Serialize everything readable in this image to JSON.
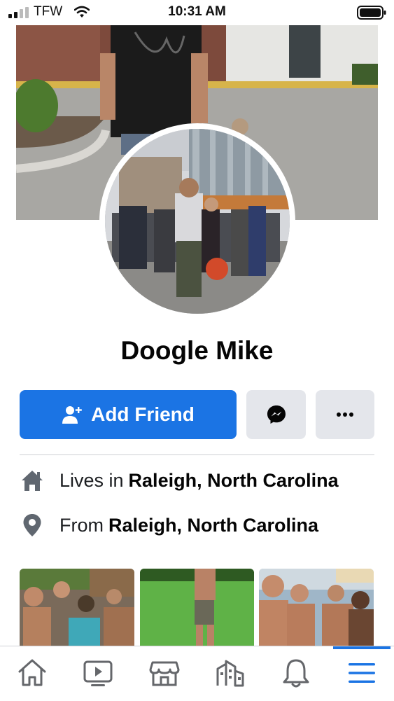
{
  "status_bar": {
    "carrier": "TFW",
    "time": "10:31 AM"
  },
  "profile": {
    "name": "Doogle Mike",
    "add_friend_label": "Add Friend",
    "message_icon": "messenger-icon",
    "more_icon": "more-dots-icon"
  },
  "details": [
    {
      "icon": "home-icon",
      "prefix": "Lives in",
      "value": "Raleigh, North Carolina"
    },
    {
      "icon": "location-pin-icon",
      "prefix": "From",
      "value": "Raleigh, North Carolina"
    }
  ],
  "tabs": [
    {
      "icon": "home-tab-icon",
      "active": false
    },
    {
      "icon": "watch-tab-icon",
      "active": false
    },
    {
      "icon": "marketplace-tab-icon",
      "active": false
    },
    {
      "icon": "pages-tab-icon",
      "active": false
    },
    {
      "icon": "notifications-tab-icon",
      "active": false
    },
    {
      "icon": "menu-tab-icon",
      "active": true
    }
  ],
  "colors": {
    "accent": "#1b74e4",
    "secondary_button": "#e4e6eb",
    "text": "#050505"
  }
}
